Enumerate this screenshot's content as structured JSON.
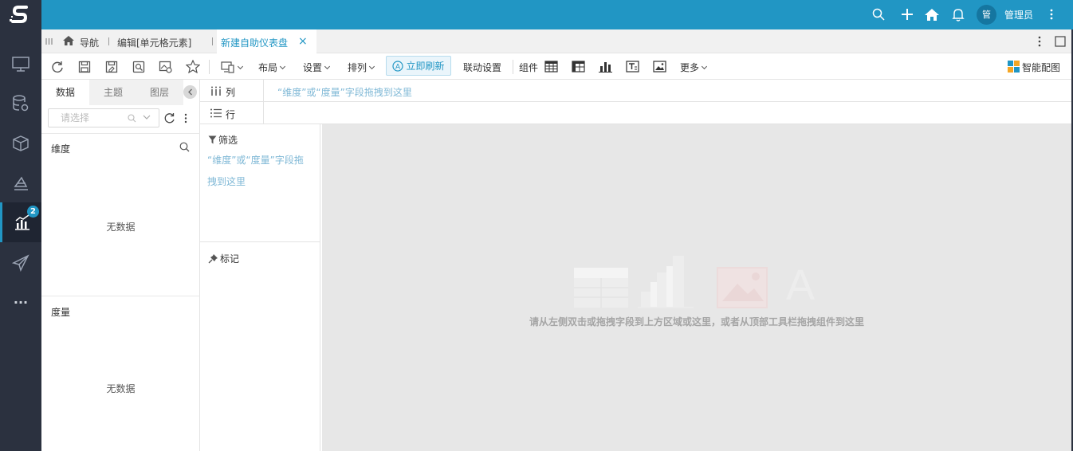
{
  "app": {
    "logo_letter": "S"
  },
  "header": {
    "avatar_text": "管",
    "user_name": "管理员"
  },
  "rail": {
    "badge_count": "2",
    "more_text": "···"
  },
  "tabs": {
    "nav_label": "导航",
    "edit_label": "编辑[单元格元素]",
    "active_label": "新建自助仪表盘",
    "close_glyph": "×"
  },
  "toolbar": {
    "layout_label": "布局",
    "settings_label": "设置",
    "arrange_label": "排列",
    "refresh_label": "立即刷新",
    "linkage_label": "联动设置",
    "component_label": "组件",
    "more_label": "更多",
    "smart_chart_label": "智能配图"
  },
  "data_panel": {
    "tabs": [
      "数据",
      "主题",
      "图层"
    ],
    "search_placeholder": "请选择",
    "dimension_title": "维度",
    "dimension_empty": "无数据",
    "measure_title": "度量",
    "measure_empty": "无数据"
  },
  "shelves": {
    "column_label": "列",
    "row_label": "行",
    "column_hint": "“维度”或“度量”字段拖拽到这里"
  },
  "filter_panel": {
    "filter_title": "筛选",
    "filter_hint": "“维度”或“度量”字段拖拽到这里",
    "mark_title": "标记"
  },
  "canvas": {
    "message": "请从左侧双击或拖拽字段到上方区域或这里，或者从顶部工具栏拖拽组件到这里"
  },
  "colors": {
    "header_blue": "#2196c4",
    "rail_dark": "#2b313f",
    "hint_blue": "#7fb8d6",
    "canvas_gray": "#e7e7e7"
  }
}
